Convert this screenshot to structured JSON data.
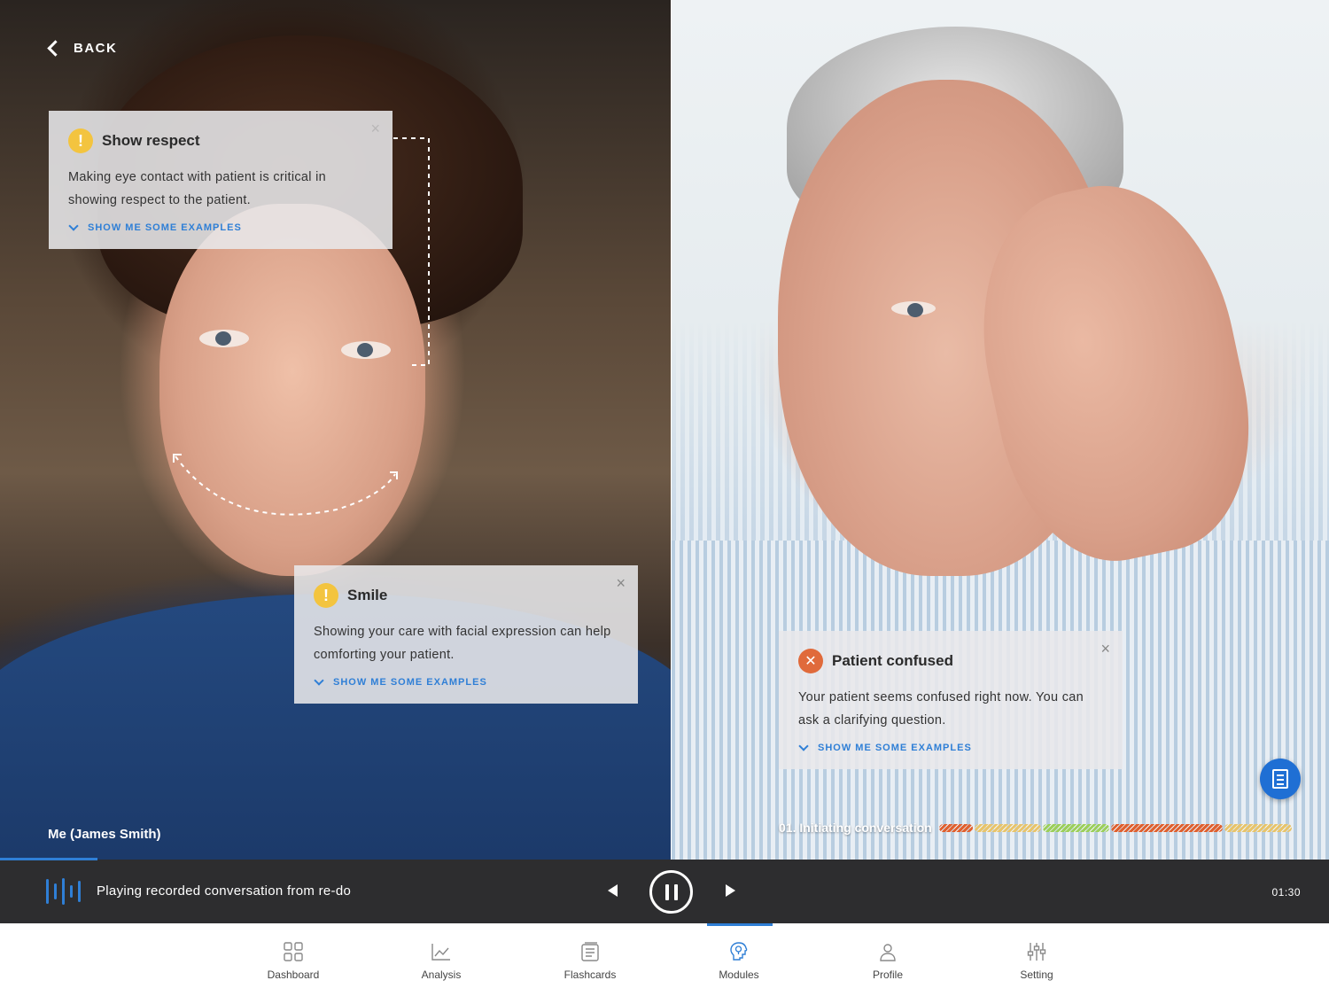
{
  "back": {
    "label": "BACK"
  },
  "tips": {
    "respect": {
      "title": "Show respect",
      "body": "Making eye contact with patient is critical in showing respect to the patient.",
      "examples": "SHOW ME SOME EXAMPLES"
    },
    "smile": {
      "title": "Smile",
      "body": "Showing your care with facial expression can help comforting your patient.",
      "examples": "SHOW ME SOME EXAMPLES"
    },
    "confused": {
      "title": "Patient confused",
      "body": "Your patient seems confused right now. You can ask a clarifying question.",
      "examples": "SHOW ME SOME EXAMPLES"
    }
  },
  "self_label": "Me (James Smith)",
  "conversation": {
    "label": "01. Initiating conversation",
    "segment_colors": [
      "#e0602e",
      "#e8c46a",
      "#9ccf5a",
      "#e0602e",
      "#e8c46a"
    ]
  },
  "player": {
    "status_text": "Playing recorded conversation from re-do",
    "time": "01:30",
    "progress": 0.073
  },
  "nav": {
    "items": [
      {
        "label": "Dashboard",
        "icon": "grid-icon"
      },
      {
        "label": "Analysis",
        "icon": "chart-icon"
      },
      {
        "label": "Flashcards",
        "icon": "cards-icon"
      },
      {
        "label": "Modules",
        "icon": "head-lightbulb-icon",
        "active": true
      },
      {
        "label": "Profile",
        "icon": "person-icon"
      },
      {
        "label": "Setting",
        "icon": "sliders-icon"
      }
    ]
  },
  "colors": {
    "accent": "#2f7fd6",
    "warning": "#f3c43f",
    "error": "#e06a3b",
    "player_bg": "#2d2d2f"
  }
}
